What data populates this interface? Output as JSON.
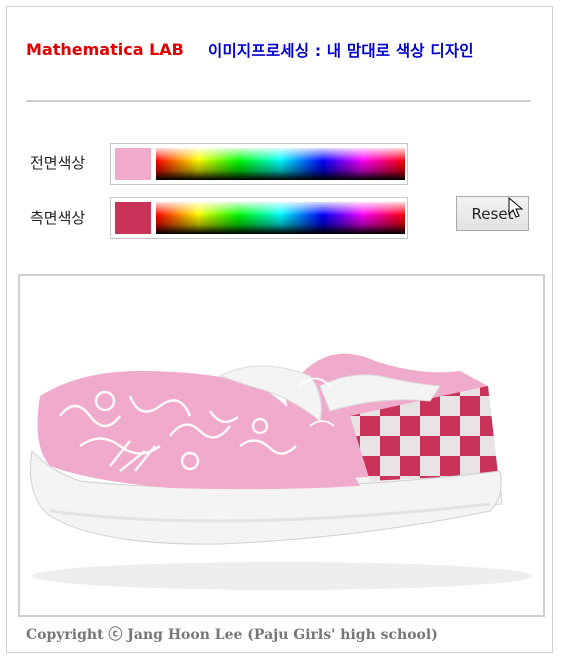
{
  "header": {
    "brand": "Mathematica LAB",
    "title": "이미지프로세싱 : 내 맘대로 색상 디자인",
    "brand_color": "#e00000",
    "title_color": "#0000cc"
  },
  "controls": {
    "front": {
      "label": "전면색상",
      "color": "#f0aacb"
    },
    "side": {
      "label": "측면색상",
      "color": "#c9335a"
    },
    "reset_label": "Reset"
  },
  "image": {
    "icon": "slip-on-sneaker-image",
    "upper_color": "#f0aacb",
    "check_color": "#c9335a",
    "sole_color": "#f2f2f2"
  },
  "footer": {
    "text": "Copyright ⓒ Jang Hoon Lee (Paju Girls' high school)"
  }
}
